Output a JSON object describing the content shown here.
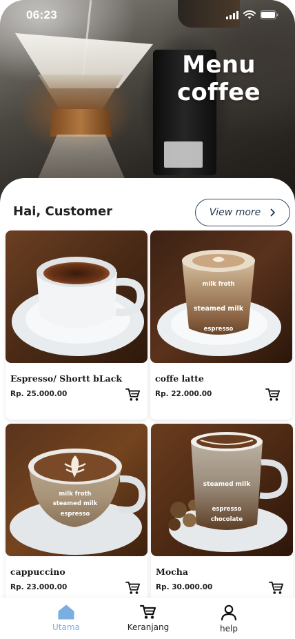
{
  "status_bar": {
    "time": "06:23"
  },
  "hero": {
    "title_line1": "Menu",
    "title_line2": "coffee"
  },
  "greeting": "Hai, Customer",
  "view_more": {
    "label": "View more"
  },
  "products": [
    {
      "name": "Espresso/ Shortt bLack",
      "price": "Rp. 25.000.00"
    },
    {
      "name": "coffe latte",
      "price": "Rp. 22.000.00"
    },
    {
      "name": "cappuccino",
      "price": "Rp. 23.000.00"
    },
    {
      "name": "Mocha",
      "price": "Rp. 30.000.00"
    }
  ],
  "cup_labels": {
    "milk_froth": "milk froth",
    "steamed_milk": "steamed milk",
    "espresso": "espresso",
    "chocolate": "chocolate"
  },
  "bottom_nav": [
    {
      "label": "Utama",
      "icon": "home-icon",
      "active": true
    },
    {
      "label": "Keranjang",
      "icon": "cart-icon",
      "active": false
    },
    {
      "label": "help",
      "icon": "user-icon",
      "active": false
    }
  ],
  "colors": {
    "accent_active": "#7aaee0",
    "button_border": "#2f4a6a",
    "text_dark": "#222222"
  }
}
